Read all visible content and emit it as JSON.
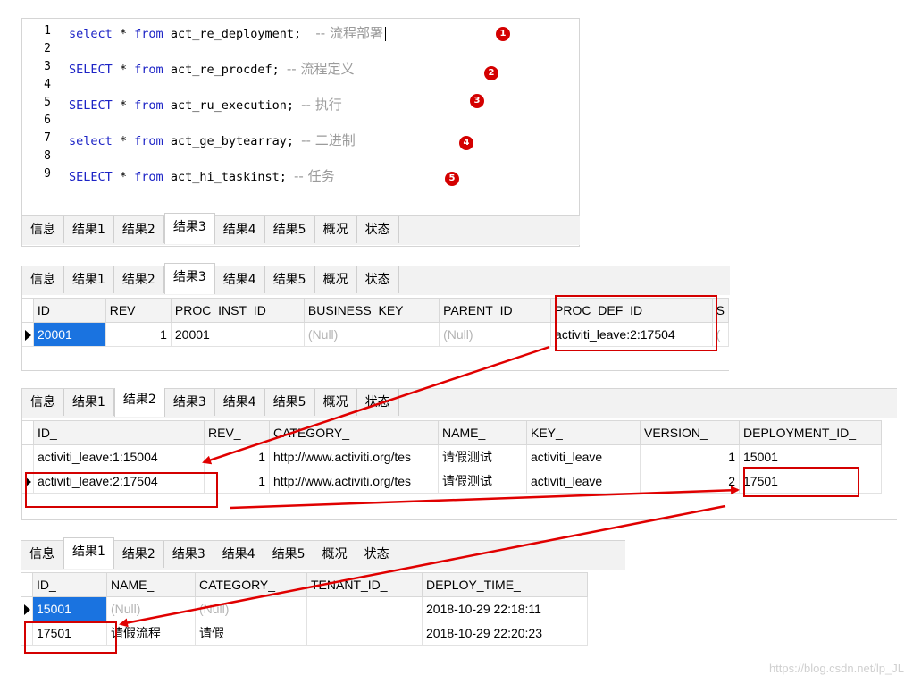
{
  "editor": {
    "lines": [
      {
        "n": "1",
        "kw": "select",
        "rest": " * ",
        "from": "from",
        "tbl": " act_re_deployment;  ",
        "comment": "-- 流程部署"
      },
      {
        "n": "2"
      },
      {
        "n": "3",
        "kw": "SELECT",
        "rest": " * ",
        "from": "from",
        "tbl": " act_re_procdef; ",
        "comment": "-- 流程定义"
      },
      {
        "n": "4"
      },
      {
        "n": "5",
        "kw": "SELECT",
        "rest": " * ",
        "from": "from",
        "tbl": " act_ru_execution; ",
        "comment": "-- 执行"
      },
      {
        "n": "6"
      },
      {
        "n": "7",
        "kw": "select",
        "rest": " * ",
        "from": "from",
        "tbl": " act_ge_bytearray; ",
        "comment": "-- 二进制"
      },
      {
        "n": "8"
      },
      {
        "n": "9",
        "kw": "SELECT",
        "rest": " * ",
        "from": "from",
        "tbl": " act_hi_taskinst; ",
        "comment": "-- 任务"
      }
    ],
    "markers": [
      "1",
      "2",
      "3",
      "4",
      "5"
    ]
  },
  "tabs": [
    "信息",
    "结果1",
    "结果2",
    "结果3",
    "结果4",
    "结果5",
    "概况",
    "状态"
  ],
  "execution": {
    "columns": [
      "ID_",
      "REV_",
      "PROC_INST_ID_",
      "BUSINESS_KEY_",
      "PARENT_ID_",
      "PROC_DEF_ID_",
      "S"
    ],
    "rows": [
      [
        "20001",
        "1",
        "20001",
        "(Null)",
        "(Null)",
        "activiti_leave:2:17504",
        "("
      ]
    ]
  },
  "procdef": {
    "columns": [
      "ID_",
      "REV_",
      "CATEGORY_",
      "NAME_",
      "KEY_",
      "VERSION_",
      "DEPLOYMENT_ID_"
    ],
    "rows": [
      [
        "activiti_leave:1:15004",
        "1",
        "http://www.activiti.org/tes",
        "请假测试",
        "activiti_leave",
        "1",
        "15001"
      ],
      [
        "activiti_leave:2:17504",
        "1",
        "http://www.activiti.org/tes",
        "请假测试",
        "activiti_leave",
        "2",
        "17501"
      ]
    ]
  },
  "deployment": {
    "columns": [
      "ID_",
      "NAME_",
      "CATEGORY_",
      "TENANT_ID_",
      "DEPLOY_TIME_"
    ],
    "rows": [
      [
        "15001",
        "(Null)",
        "(Null)",
        "",
        "2018-10-29 22:18:11"
      ],
      [
        "17501",
        "请假流程",
        "请假",
        "",
        "2018-10-29 22:20:23"
      ]
    ]
  },
  "watermark": "https://blog.csdn.net/lp_JL",
  "colors": {
    "accent": "#d40000",
    "selection": "#1a73e0",
    "keyword": "#1d24c6"
  }
}
